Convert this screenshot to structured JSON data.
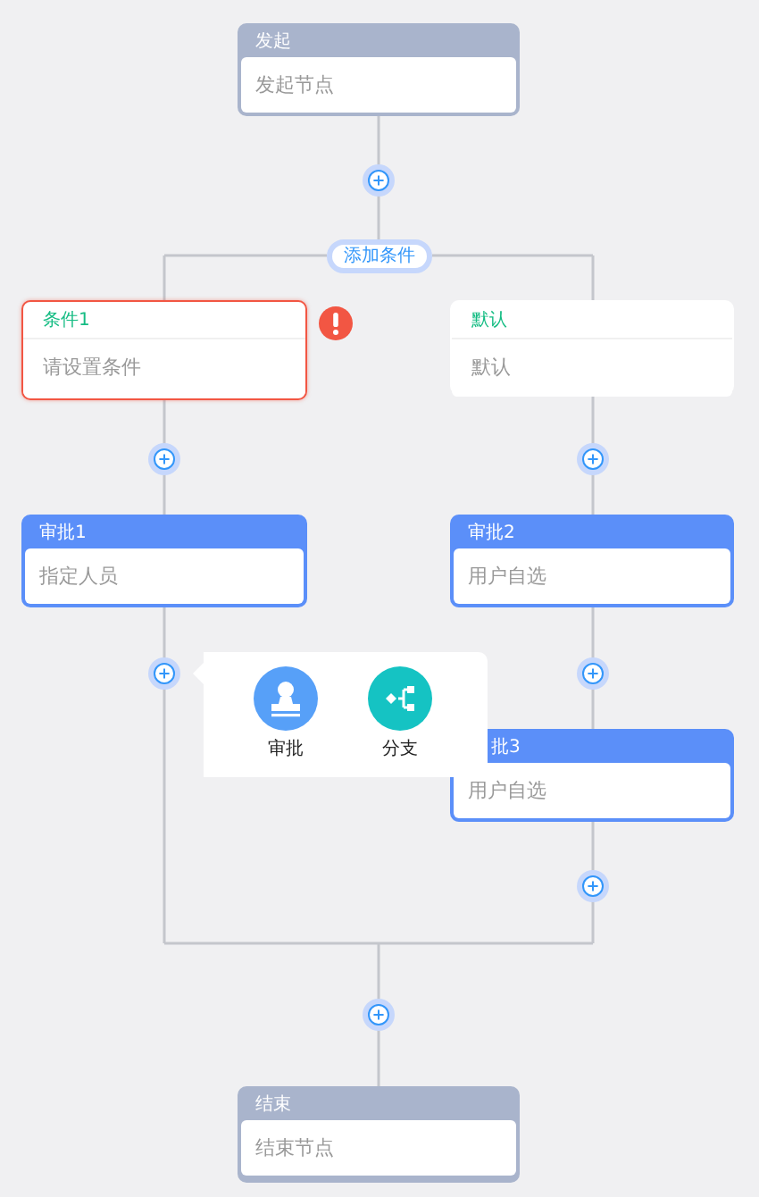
{
  "nodes": [
    {
      "kind": "start",
      "title": "发起",
      "content": "发起节点"
    },
    {
      "kind": "condition",
      "title": "条件1",
      "content": "请设置条件",
      "error": true
    },
    {
      "kind": "condition",
      "title": "默认",
      "content": "默认",
      "error": false
    },
    {
      "kind": "approver",
      "title": "审批1",
      "content": "指定人员"
    },
    {
      "kind": "approver",
      "title": "审批2",
      "content": "用户自选"
    },
    {
      "kind": "approver",
      "title": "批3",
      "content": "用户自选",
      "covered": true
    },
    {
      "kind": "end",
      "title": "结束",
      "content": "结束节点"
    }
  ],
  "add_condition": "添加条件",
  "popup": {
    "items": [
      {
        "kind": "approver",
        "label": "审批"
      },
      {
        "kind": "branch",
        "label": "分支"
      }
    ]
  }
}
